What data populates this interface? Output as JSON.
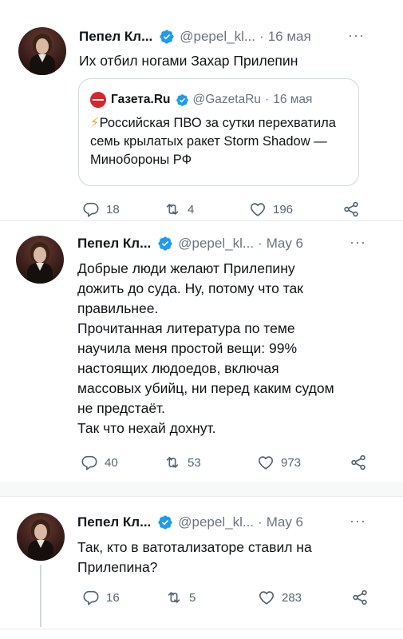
{
  "tweets": [
    {
      "author_name": "Пепел Кл...",
      "handle": "@pepel_kl...",
      "separator": "·",
      "date": "16 мая",
      "more": "···",
      "text": "Их отбил ногами Захар Прилепин",
      "quote": {
        "author_name": "Газета.Ru",
        "handle": "@GazetaRu",
        "separator": "·",
        "date": "16 мая",
        "icon": "⚡",
        "text": "Российская ПВО за сутки перехватила семь крылатых ракет Storm Shadow — Минобороны РФ"
      },
      "replies": "18",
      "reposts": "4",
      "likes": "196"
    },
    {
      "author_name": "Пепел Кл...",
      "handle": "@pepel_kl...",
      "separator": "·",
      "date": "May 6",
      "more": "···",
      "lines": [
        "Добрые люди желают Прилепину",
        "дожить до суда. Ну, потому что так",
        "правильнее.",
        "Прочитанная литература по теме",
        "научила меня простой вещи: 99%",
        "настоящих людоедов, включая",
        "массовых убийц, ни перед каким судом",
        "не предстаёт.",
        "Так что нехай дохнут."
      ],
      "replies": "40",
      "reposts": "53",
      "likes": "973"
    },
    {
      "author_name": "Пепел Кл...",
      "handle": "@pepel_kl...",
      "separator": "·",
      "date": "May 6",
      "more": "···",
      "lines": [
        "Так, кто в ватотализаторе ставил на",
        "Прилепина?"
      ],
      "replies": "16",
      "reposts": "5",
      "likes": "283"
    }
  ],
  "colors": {
    "verified": "#1d9bf0",
    "muted": "#536471",
    "quote_logo": "#d6262e"
  },
  "icons": [
    "reply-icon",
    "repost-icon",
    "like-icon",
    "share-icon",
    "verified-icon"
  ]
}
